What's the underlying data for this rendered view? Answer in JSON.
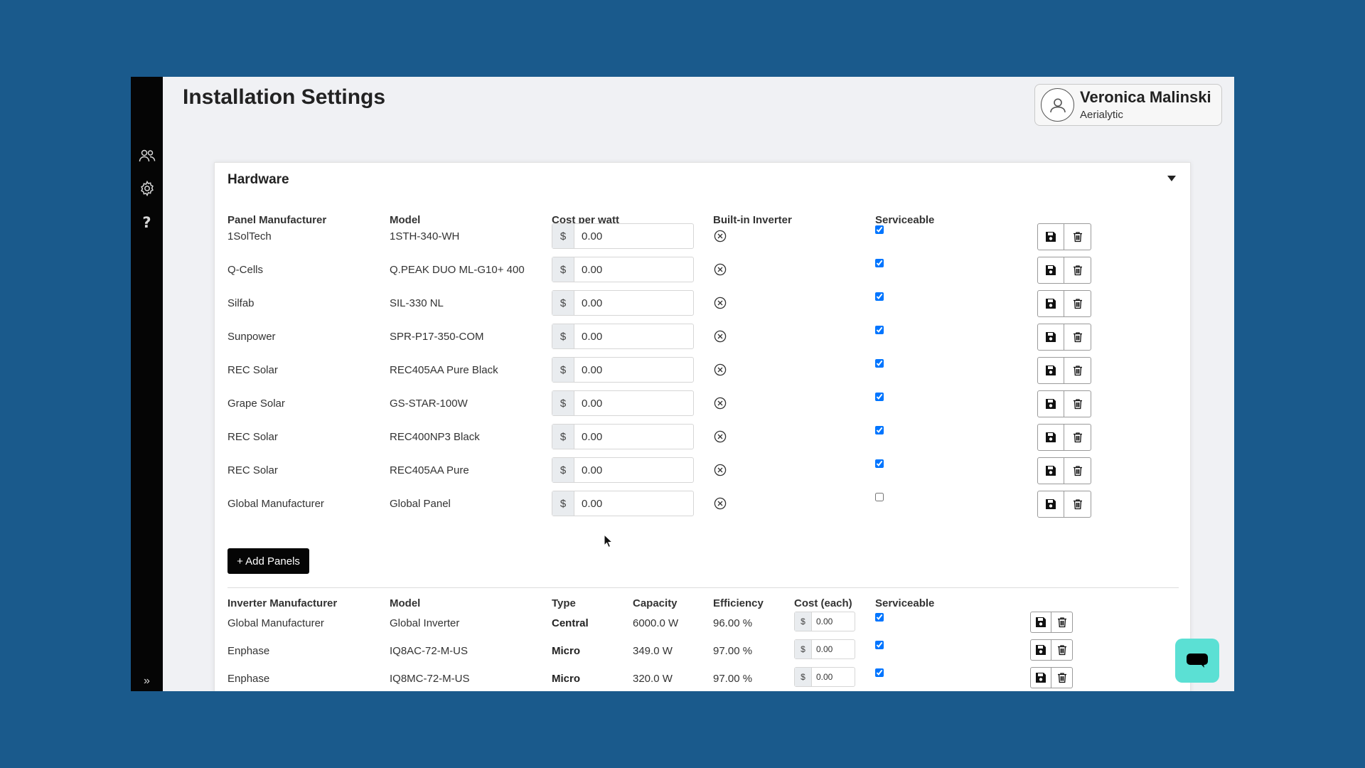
{
  "page": {
    "title": "Installation Settings"
  },
  "user": {
    "name": "Veronica Malinski",
    "org": "Aerialytic"
  },
  "sidebar": {
    "items": [
      {
        "icon": "users-icon"
      },
      {
        "icon": "gear-icon"
      },
      {
        "icon": "help-icon",
        "glyph": "?"
      }
    ],
    "expand_glyph": "»"
  },
  "hardware": {
    "title": "Hardware",
    "panels": {
      "headers": [
        "Panel Manufacturer",
        "Model",
        "Cost per watt",
        "Built-in Inverter",
        "Serviceable"
      ],
      "currency": "$",
      "rows": [
        {
          "manufacturer": "1SolTech",
          "model": "1STH-340-WH",
          "cost": "0.00",
          "builtin_inverter": false,
          "serviceable": true
        },
        {
          "manufacturer": "Q-Cells",
          "model": "Q.PEAK DUO ML-G10+ 400",
          "cost": "0.00",
          "builtin_inverter": false,
          "serviceable": true
        },
        {
          "manufacturer": "Silfab",
          "model": "SIL-330 NL",
          "cost": "0.00",
          "builtin_inverter": false,
          "serviceable": true
        },
        {
          "manufacturer": "Sunpower",
          "model": "SPR-P17-350-COM",
          "cost": "0.00",
          "builtin_inverter": false,
          "serviceable": true
        },
        {
          "manufacturer": "REC Solar",
          "model": "REC405AA Pure Black",
          "cost": "0.00",
          "builtin_inverter": false,
          "serviceable": true
        },
        {
          "manufacturer": "Grape Solar",
          "model": "GS-STAR-100W",
          "cost": "0.00",
          "builtin_inverter": false,
          "serviceable": true
        },
        {
          "manufacturer": "REC Solar",
          "model": "REC400NP3 Black",
          "cost": "0.00",
          "builtin_inverter": false,
          "serviceable": true
        },
        {
          "manufacturer": "REC Solar",
          "model": "REC405AA Pure",
          "cost": "0.00",
          "builtin_inverter": false,
          "serviceable": true
        },
        {
          "manufacturer": "Global Manufacturer",
          "model": "Global Panel",
          "cost": "0.00",
          "builtin_inverter": false,
          "serviceable": false
        }
      ],
      "add_label": "+ Add Panels"
    },
    "inverters": {
      "headers": [
        "Inverter Manufacturer",
        "Model",
        "Type",
        "Capacity",
        "Efficiency",
        "Cost (each)",
        "Serviceable"
      ],
      "currency": "$",
      "rows": [
        {
          "manufacturer": "Global Manufacturer",
          "model": "Global Inverter",
          "type": "Central",
          "capacity": "6000.0 W",
          "efficiency": "96.00 %",
          "cost": "0.00",
          "serviceable": true
        },
        {
          "manufacturer": "Enphase",
          "model": "IQ8AC-72-M-US",
          "type": "Micro",
          "capacity": "349.0 W",
          "efficiency": "97.00 %",
          "cost": "0.00",
          "serviceable": true
        },
        {
          "manufacturer": "Enphase",
          "model": "IQ8MC-72-M-US",
          "type": "Micro",
          "capacity": "320.0 W",
          "efficiency": "97.00 %",
          "cost": "0.00",
          "serviceable": true
        }
      ]
    }
  },
  "colors": {
    "backdrop": "#1a5a8c",
    "sidebar": "#050505",
    "chat": "#5be0d4",
    "primary_button": "#050505"
  }
}
